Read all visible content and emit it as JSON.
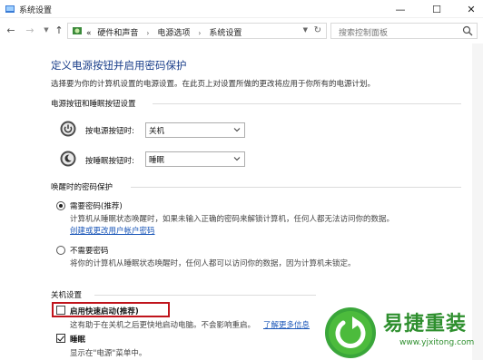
{
  "window": {
    "title": "系统设置"
  },
  "nav": {
    "breadcrumb_prefix": "«",
    "breadcrumbs": [
      "硬件和声音",
      "电源选项",
      "系统设置"
    ],
    "search_placeholder": "搜索控制面板"
  },
  "page": {
    "heading": "定义电源按钮并启用密码保护",
    "subtext": "选择要为你的计算机设置的电源设置。在此页上对设置所做的更改将应用于你所有的电源计划。"
  },
  "buttons_group": {
    "label": "电源按钮和睡眠按钮设置",
    "power_label": "按电源按钮时:",
    "power_value": "关机",
    "sleep_label": "按睡眠按钮时:",
    "sleep_value": "睡眠"
  },
  "wake_group": {
    "label": "唤醒时的密码保护",
    "require_label": "需要密码(推荐)",
    "require_desc": "计算机从睡眠状态唤醒时，如果未输入正确的密码来解锁计算机，任何人都无法访问你的数据。",
    "require_link": "创建或更改用户帐户密码",
    "norequire_label": "不需要密码",
    "norequire_desc": "将你的计算机从睡眠状态唤醒时，任何人都可以访问你的数据，因为计算机未锁定。"
  },
  "shutdown_group": {
    "label": "关机设置",
    "fast_startup_label": "启用快速启动(推荐)",
    "fast_startup_desc": "这有助于在关机之后更快地启动电脑。不会影响重启。",
    "learn_more_link": "了解更多信息",
    "sleep_label": "睡眠",
    "sleep_desc": "显示在\"电源\"菜单中。"
  },
  "watermark": {
    "brand": "易捷重装",
    "url": "www.yjxitong.com"
  },
  "colors": {
    "heading": "#1a3e8a",
    "link": "#1a56b8",
    "highlight": "#c0141c",
    "brand": "#2e8f2e"
  }
}
